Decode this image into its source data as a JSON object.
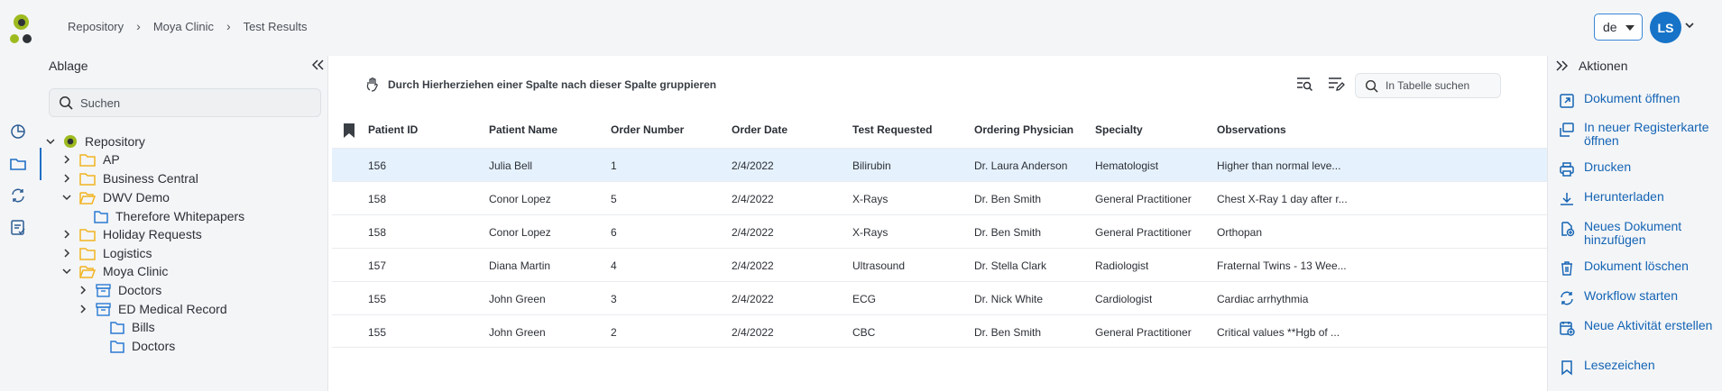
{
  "breadcrumb": [
    "Repository",
    "Moya Clinic",
    "Test Results"
  ],
  "header": {
    "lang": "de",
    "avatar_initials": "LS"
  },
  "left_panel": {
    "title": "Ablage",
    "search_placeholder": "Suchen",
    "tree": [
      {
        "label": "Repository",
        "level": 0,
        "type": "repo",
        "expanded": true
      },
      {
        "label": "AP",
        "level": 1,
        "type": "folder",
        "expanded": false
      },
      {
        "label": "Business Central",
        "level": 1,
        "type": "folder",
        "expanded": false
      },
      {
        "label": "DWV Demo",
        "level": 1,
        "type": "folder",
        "expanded": true
      },
      {
        "label": "Therefore Whitepapers",
        "level": 2,
        "type": "category",
        "expanded": null
      },
      {
        "label": "Holiday Requests",
        "level": 1,
        "type": "folder",
        "expanded": false
      },
      {
        "label": "Logistics",
        "level": 1,
        "type": "folder",
        "expanded": false
      },
      {
        "label": "Moya Clinic",
        "level": 1,
        "type": "folder",
        "expanded": true
      },
      {
        "label": "Doctors",
        "level": 2,
        "type": "case",
        "expanded": false
      },
      {
        "label": "ED Medical Record",
        "level": 2,
        "type": "case",
        "expanded": false
      },
      {
        "label": "Bills",
        "level": 2,
        "type": "category",
        "expanded": null
      },
      {
        "label": "Doctors",
        "level": 2,
        "type": "category",
        "expanded": null
      }
    ]
  },
  "main": {
    "group_hint": "Durch Hierherziehen einer Spalte nach dieser Spalte gruppieren",
    "table_search_placeholder": "In Tabelle suchen",
    "columns": [
      "Patient ID",
      "Patient Name",
      "Order Number",
      "Order Date",
      "Test Requested",
      "Ordering Physician",
      "Specialty",
      "Observations"
    ],
    "rows": [
      [
        "156",
        "Julia Bell",
        "1",
        "2/4/2022",
        "Bilirubin",
        "Dr. Laura Anderson",
        "Hematologist",
        "Higher than normal leve..."
      ],
      [
        "158",
        "Conor Lopez",
        "5",
        "2/4/2022",
        "X-Rays",
        "Dr. Ben Smith",
        "General Practitioner",
        "Chest X-Ray 1 day after r..."
      ],
      [
        "158",
        "Conor Lopez",
        "6",
        "2/4/2022",
        "X-Rays",
        "Dr. Ben Smith",
        "General Practitioner",
        "Orthopan"
      ],
      [
        "157",
        "Diana Martin",
        "4",
        "2/4/2022",
        "Ultrasound",
        "Dr. Stella Clark",
        "Radiologist",
        "Fraternal Twins - 13 Wee..."
      ],
      [
        "155",
        "John Green",
        "3",
        "2/4/2022",
        "ECG",
        "Dr. Nick White",
        "Cardiologist",
        "Cardiac arrhythmia"
      ],
      [
        "155",
        "John Green",
        "2",
        "2/4/2022",
        "CBC",
        "Dr. Ben Smith",
        "General Practitioner",
        "Critical values **Hgb of ..."
      ]
    ],
    "selected_row": 0
  },
  "right_panel": {
    "title": "Aktionen",
    "actions": [
      {
        "label": "Dokument öffnen",
        "icon": "open-external-icon"
      },
      {
        "label": "In neuer Registerkarte öffnen",
        "icon": "new-tab-icon"
      },
      {
        "label": "Drucken",
        "icon": "print-icon"
      },
      {
        "label": "Herunterladen",
        "icon": "download-icon"
      },
      {
        "label": "Neues Dokument hinzufügen",
        "icon": "add-document-icon"
      },
      {
        "label": "Dokument löschen",
        "icon": "trash-icon"
      },
      {
        "label": "Workflow starten",
        "icon": "workflow-icon"
      },
      {
        "label": "Neue Aktivität erstellen",
        "icon": "new-activity-icon"
      },
      {
        "label": "Lesezeichen",
        "icon": "bookmark-icon"
      }
    ]
  },
  "colors": {
    "accent": "#1464b4",
    "brand_green": "#9dbb1f",
    "selected_row": "#e5f1fd",
    "folder": "#f2b321",
    "category": "#2a7ad2"
  }
}
